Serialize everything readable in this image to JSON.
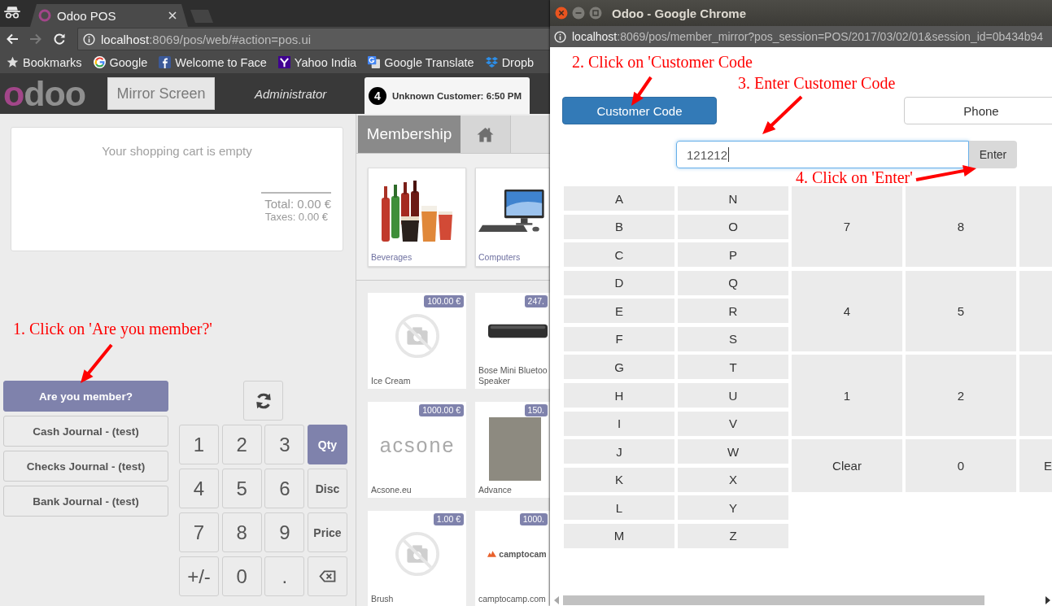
{
  "browser": {
    "tab": {
      "title": "Odoo POS"
    },
    "nav": [
      {
        "kind": "back",
        "disabled": false
      },
      {
        "kind": "forward",
        "disabled": true
      },
      {
        "kind": "reload",
        "disabled": false
      }
    ],
    "address": {
      "host": "localhost",
      "path": ":8069/pos/web/#action=pos.ui"
    },
    "bookmarks": [
      {
        "kind": "star",
        "label": "Bookmarks"
      },
      {
        "kind": "google",
        "label": "Google"
      },
      {
        "kind": "facebook",
        "label": "Welcome to Face"
      },
      {
        "kind": "yahoo",
        "label": "Yahoo India"
      },
      {
        "kind": "translate",
        "label": "Google Translate"
      },
      {
        "kind": "dropbox",
        "label": "Dropb"
      }
    ]
  },
  "pos": {
    "logo": "odoo",
    "mirror_button": "Mirror Screen",
    "user": "Administrator",
    "order_tab": {
      "number": "4",
      "label": "Unknown Customer: 6:50 PM",
      "selected": true
    },
    "cart": {
      "empty_text": "Your shopping cart is empty",
      "total": "Total: 0.00 €",
      "taxes": "Taxes: 0.00 €"
    },
    "payment_buttons": [
      {
        "label": "Are you member?",
        "selected": true
      },
      {
        "label": "Cash Journal - (test)",
        "selected": false
      },
      {
        "label": "Checks Journal - (test)",
        "selected": false
      },
      {
        "label": "Bank Journal - (test)",
        "selected": false
      }
    ],
    "numpad": [
      {
        "kind": "digit",
        "label": "1",
        "selected": false
      },
      {
        "kind": "digit",
        "label": "2",
        "selected": false
      },
      {
        "kind": "digit",
        "label": "3",
        "selected": false
      },
      {
        "kind": "mode",
        "label": "Qty",
        "selected": true
      },
      {
        "kind": "digit",
        "label": "4",
        "selected": false
      },
      {
        "kind": "digit",
        "label": "5",
        "selected": false
      },
      {
        "kind": "digit",
        "label": "6",
        "selected": false
      },
      {
        "kind": "mode",
        "label": "Disc",
        "selected": false
      },
      {
        "kind": "digit",
        "label": "7",
        "selected": false
      },
      {
        "kind": "digit",
        "label": "8",
        "selected": false
      },
      {
        "kind": "digit",
        "label": "9",
        "selected": false
      },
      {
        "kind": "mode",
        "label": "Price",
        "selected": false
      },
      {
        "kind": "digit",
        "label": "+/-",
        "selected": false
      },
      {
        "kind": "digit",
        "label": "0",
        "selected": false
      },
      {
        "kind": "digit",
        "label": ".",
        "selected": false
      },
      {
        "kind": "backspace",
        "selected": false
      }
    ],
    "breadcrumb": "Membership",
    "categories": [
      {
        "kind": "beverages",
        "name": "Beverages"
      },
      {
        "kind": "computers",
        "name": "Computers"
      }
    ],
    "products": [
      {
        "kind": "no-image",
        "name": "Ice Cream",
        "price": "100.00 €"
      },
      {
        "kind": "speaker",
        "name": "Bose Mini Bluetoo\nSpeaker",
        "price": "247."
      },
      {
        "kind": "wordmark",
        "name": "Acsone.eu",
        "price": "1000.00 €",
        "logo": "acsone"
      },
      {
        "kind": "photo",
        "name": "Advance",
        "price": "150."
      },
      {
        "kind": "no-image",
        "name": "Brush",
        "price": "1.00 €"
      },
      {
        "kind": "wordmark-icon",
        "name": "camptocamp.com",
        "price": "1000.",
        "logo": "camptocam"
      }
    ]
  },
  "popup": {
    "title": "Odoo - Google Chrome",
    "address": {
      "host": "localhost",
      "path": ":8069/pos/member_mirror?pos_session=POS/2017/03/02/01&session_id=0b434b94"
    },
    "modes": [
      {
        "label": "Customer Code",
        "selected": true
      },
      {
        "label": "Phone",
        "selected": false
      }
    ],
    "code_input": {
      "value": "121212",
      "focused": true
    },
    "enter_button": "Enter",
    "letters": [
      "A",
      "B",
      "C",
      "D",
      "E",
      "F",
      "G",
      "H",
      "I",
      "J",
      "K",
      "L",
      "M",
      "N",
      "O",
      "P",
      "Q",
      "R",
      "S",
      "T",
      "U",
      "V",
      "W",
      "X",
      "Y",
      "Z"
    ],
    "digit_keys": [
      {
        "kind": "key",
        "label": "7"
      },
      {
        "kind": "key",
        "label": "8"
      },
      {
        "kind": "cut"
      },
      {
        "kind": "key",
        "label": "4"
      },
      {
        "kind": "key",
        "label": "5"
      },
      {
        "kind": "cut"
      },
      {
        "kind": "key",
        "label": "1"
      },
      {
        "kind": "key",
        "label": "2"
      },
      {
        "kind": "cut"
      },
      {
        "kind": "key",
        "label": "Clear"
      },
      {
        "kind": "key",
        "label": "0"
      },
      {
        "kind": "cut",
        "label": "E"
      }
    ]
  },
  "annotations": [
    "1. Click on 'Are you member?'",
    "2. Click on 'Customer Code",
    "3. Enter Customer Code",
    "4. Click on 'Enter'"
  ]
}
